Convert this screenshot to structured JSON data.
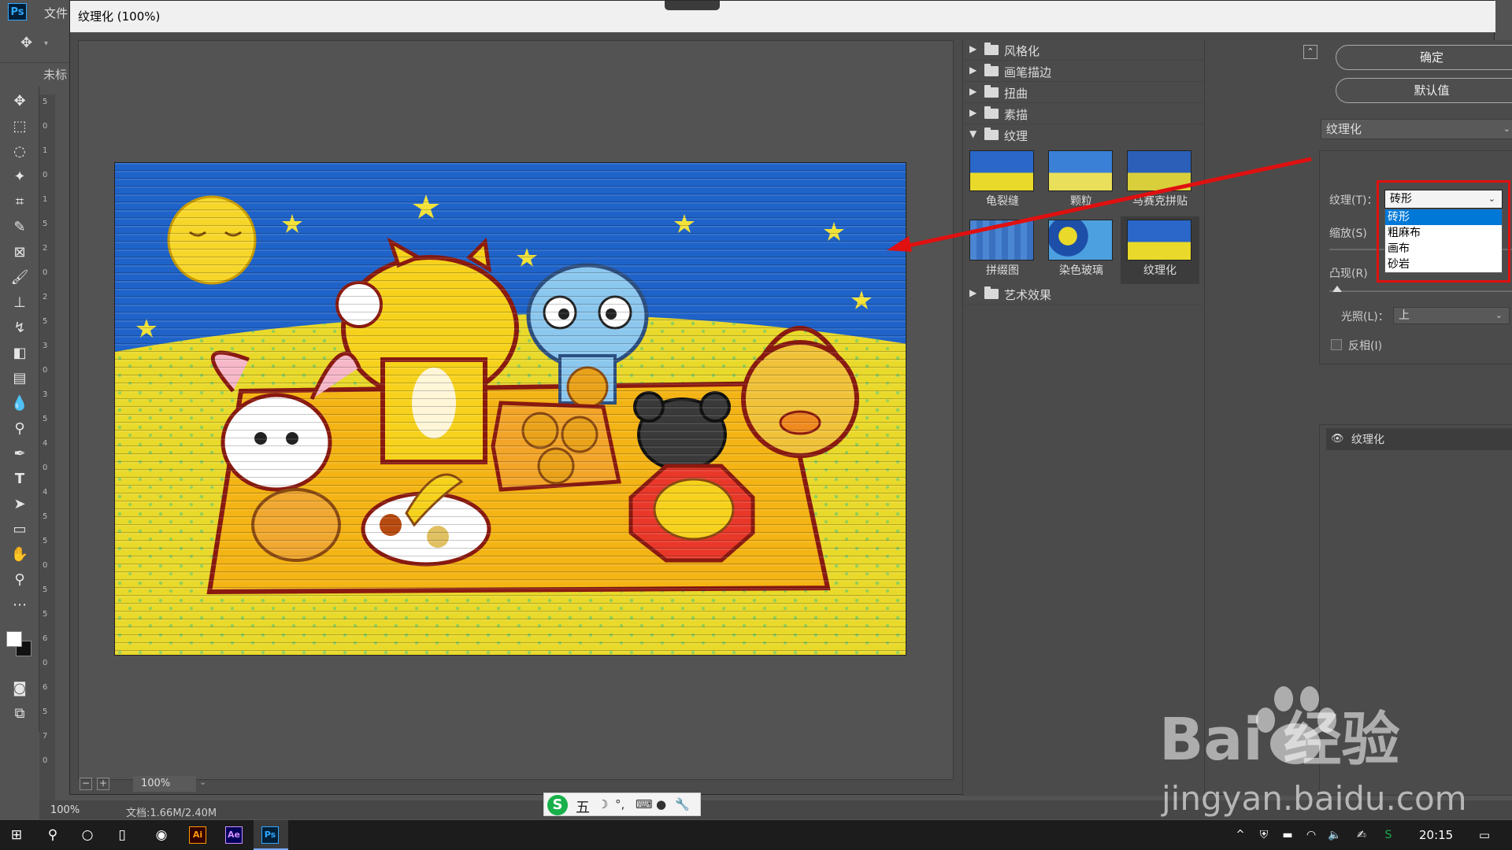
{
  "app": {
    "menu_file": "文件",
    "ps_logo_text": "Ps",
    "doc_tab": "未标",
    "zoom": "100%",
    "doc_size": "文档:1.66M/2.40M",
    "ruler_digits": [
      "5",
      "0",
      "1",
      "0",
      "1",
      "5",
      "2",
      "0",
      "2",
      "5",
      "3",
      "0",
      "3",
      "5",
      "4",
      "0",
      "4",
      "5",
      "5",
      "0",
      "5",
      "5",
      "6",
      "0",
      "6",
      "5",
      "7",
      "0"
    ]
  },
  "dialog": {
    "title": "纹理化 (100%)",
    "zoom_level": "100%",
    "zoom_minus": "−",
    "zoom_plus": "+"
  },
  "filter_categories": [
    {
      "label": "风格化",
      "expanded": false
    },
    {
      "label": "画笔描边",
      "expanded": false
    },
    {
      "label": "扭曲",
      "expanded": false
    },
    {
      "label": "素描",
      "expanded": false
    },
    {
      "label": "纹理",
      "expanded": true
    },
    {
      "label": "艺术效果",
      "expanded": false
    }
  ],
  "texture_filters": [
    {
      "label": "龟裂缝"
    },
    {
      "label": "颗粒"
    },
    {
      "label": "马赛克拼贴"
    },
    {
      "label": "拼缀图"
    },
    {
      "label": "染色玻璃"
    },
    {
      "label": "纹理化",
      "selected": true
    }
  ],
  "settings": {
    "ok_label": "确定",
    "default_label": "默认值",
    "filter_name": "纹理化",
    "texture_label": "纹理(T)：",
    "texture_value": "砖形",
    "texture_options": [
      "砖形",
      "粗麻布",
      "画布",
      "砂岩"
    ],
    "scale_label": "缩放(S)",
    "scale_unit": "%",
    "relief_label": "凸现(R)",
    "relief_fraction": 0.04,
    "light_label": "光照(L)：",
    "light_value": "上",
    "invert_label": "反相(I)",
    "invert_checked": false
  },
  "layers": {
    "layer_name": "纹理化"
  },
  "ime": {
    "mode": "五",
    "logo": "S"
  },
  "taskbar": {
    "time": "20:15"
  },
  "watermark": {
    "logo_text": "Bai  经验",
    "url": "jingyan.baidu.com"
  },
  "colors": {
    "highlight": "#e01010",
    "selection": "#0078d7",
    "sky": "#1f63c9",
    "ground": "#e9d92a"
  }
}
